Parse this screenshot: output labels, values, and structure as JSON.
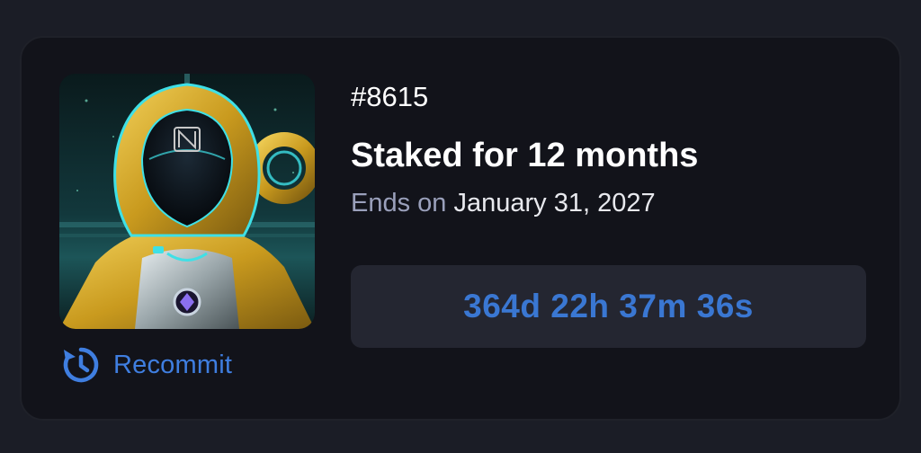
{
  "card": {
    "token_id": "#8615",
    "stake_title": "Staked for 12 months",
    "ends_prefix": "Ends on",
    "ends_date": "January 31, 2027",
    "countdown": "364d 22h 37m 36s",
    "recommit_label": "Recommit",
    "recommit_icon": "history-refresh-icon",
    "image_icon": "nft-hooded-figure-image"
  },
  "colors": {
    "page_bg": "#1b1d26",
    "card_bg": "#12131a",
    "accent_blue": "#3f7ee0",
    "countdown_bg": "#242631",
    "muted_text": "#9aa0bb",
    "gold": "#d4a62a",
    "cyan_glow": "#3fe0e6"
  }
}
